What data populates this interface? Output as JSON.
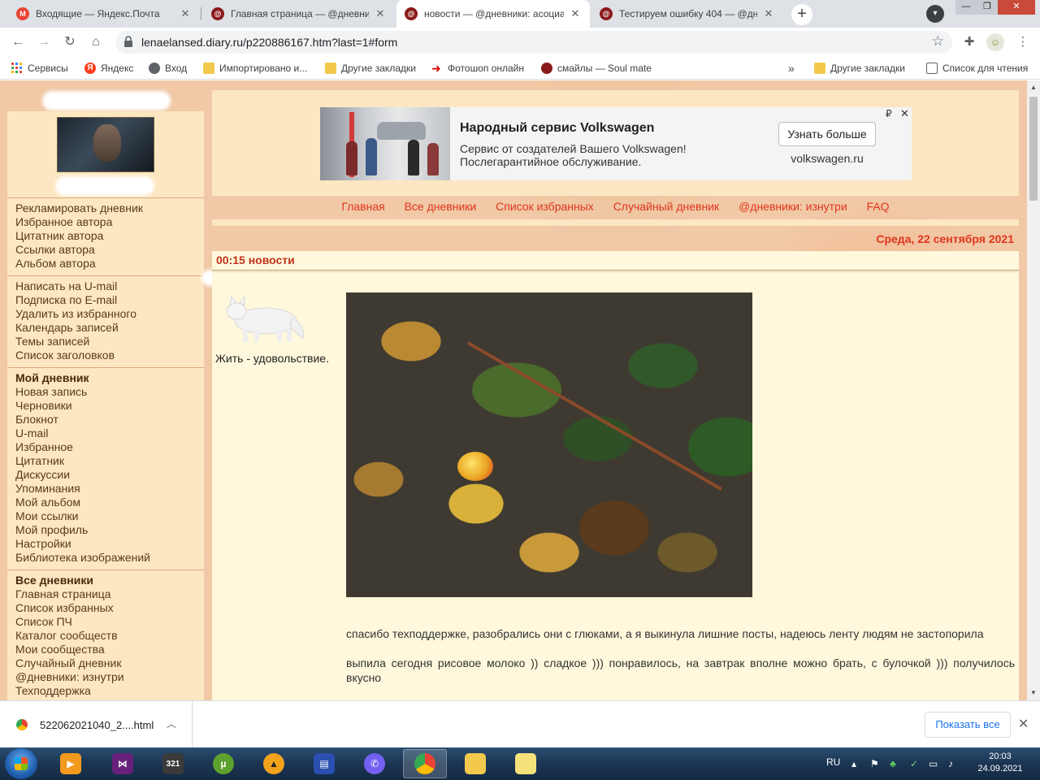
{
  "browser": {
    "tabs": [
      {
        "title": "Входящие — Яндекс.Почта",
        "icon": "gmail-icon",
        "active": false
      },
      {
        "title": "Главная страница — @дневник",
        "icon": "diary-icon",
        "active": false
      },
      {
        "title": "новости — @дневники: асоциа",
        "icon": "diary-icon",
        "active": true
      },
      {
        "title": "Тестируем ошибку 404 — @дне",
        "icon": "diary-icon",
        "active": false
      }
    ],
    "url": "lenaelansed.diary.ru/p220886167.htm?last=1#form",
    "bookmarks": [
      {
        "label": "Сервисы",
        "icon": "apps-grid-icon"
      },
      {
        "label": "Яндекс",
        "icon": "yandex-icon"
      },
      {
        "label": "Вход",
        "icon": "globe-icon"
      },
      {
        "label": "Импортировано и...",
        "icon": "folder-icon"
      },
      {
        "label": "Другие закладки",
        "icon": "folder-icon"
      },
      {
        "label": "Фотошоп онлайн",
        "icon": "red-arrow-icon"
      },
      {
        "label": "смайлы — Soul mate",
        "icon": "diary-icon"
      }
    ],
    "bookmarks_more": "»",
    "bookmarks_right": [
      {
        "label": "Другие закладки",
        "icon": "folder-icon"
      },
      {
        "label": "Список для чтения",
        "icon": "reading-list-icon"
      }
    ]
  },
  "sidebar": {
    "group1": [
      "Рекламировать дневник",
      "Избранное автора",
      "Цитатник автора",
      "Ссылки автора",
      "Альбом автора"
    ],
    "group2": [
      "Написать на U-mail",
      "Подписка по E-mail",
      "Удалить из избранного",
      "Календарь записей",
      "Темы записей",
      "Список заголовков"
    ],
    "group3_head": "Мой дневник",
    "group3": [
      "Новая запись",
      "Черновики",
      "Блокнот",
      "U-mail",
      "Избранное",
      "Цитатник",
      "Дискуссии",
      "Упоминания",
      "Мой альбом",
      "Мои ссылки",
      "Мой профиль",
      "Настройки",
      "Библиотека изображений"
    ],
    "group4_head": "Все дневники",
    "group4": [
      "Главная страница",
      "Список избранных",
      "Список ПЧ",
      "Каталог сообществ",
      "Мои сообщества",
      "Случайный дневник",
      "@дневники: изнутри",
      "Техподдержка"
    ]
  },
  "ad": {
    "title": "Народный сервис Volkswagen",
    "text": "Сервис от создателей Вашего Volkswagen! Послегарантийное обслуживание.",
    "button": "Узнать больше",
    "domain": "volkswagen.ru",
    "rub": "₽",
    "close": "✕"
  },
  "topnav": [
    "Главная",
    "Все дневники",
    "Список избранных",
    "Случайный дневник",
    "@дневники: изнутри",
    "FAQ"
  ],
  "post": {
    "date": "Среда, 22 сентября 2021",
    "title": "00:15 новости",
    "epigraph": "Жить - удовольствие.",
    "paragraphs": [
      "спасибо техподдержке, разобрались они с глюками, а я выкинула лишние посты, надеюсь ленту людям не застопорила",
      "выпила сегодня рисовое молоко )) сладкое ))) понравилось, на завтрак вполне можно брать, с булочкой ))) получилось вкусно"
    ]
  },
  "download": {
    "filename": "522062021040_2....html",
    "show_all": "Показать все"
  },
  "taskbar": {
    "lang": "RU",
    "time": "20:03",
    "date": "24.09.2021"
  }
}
